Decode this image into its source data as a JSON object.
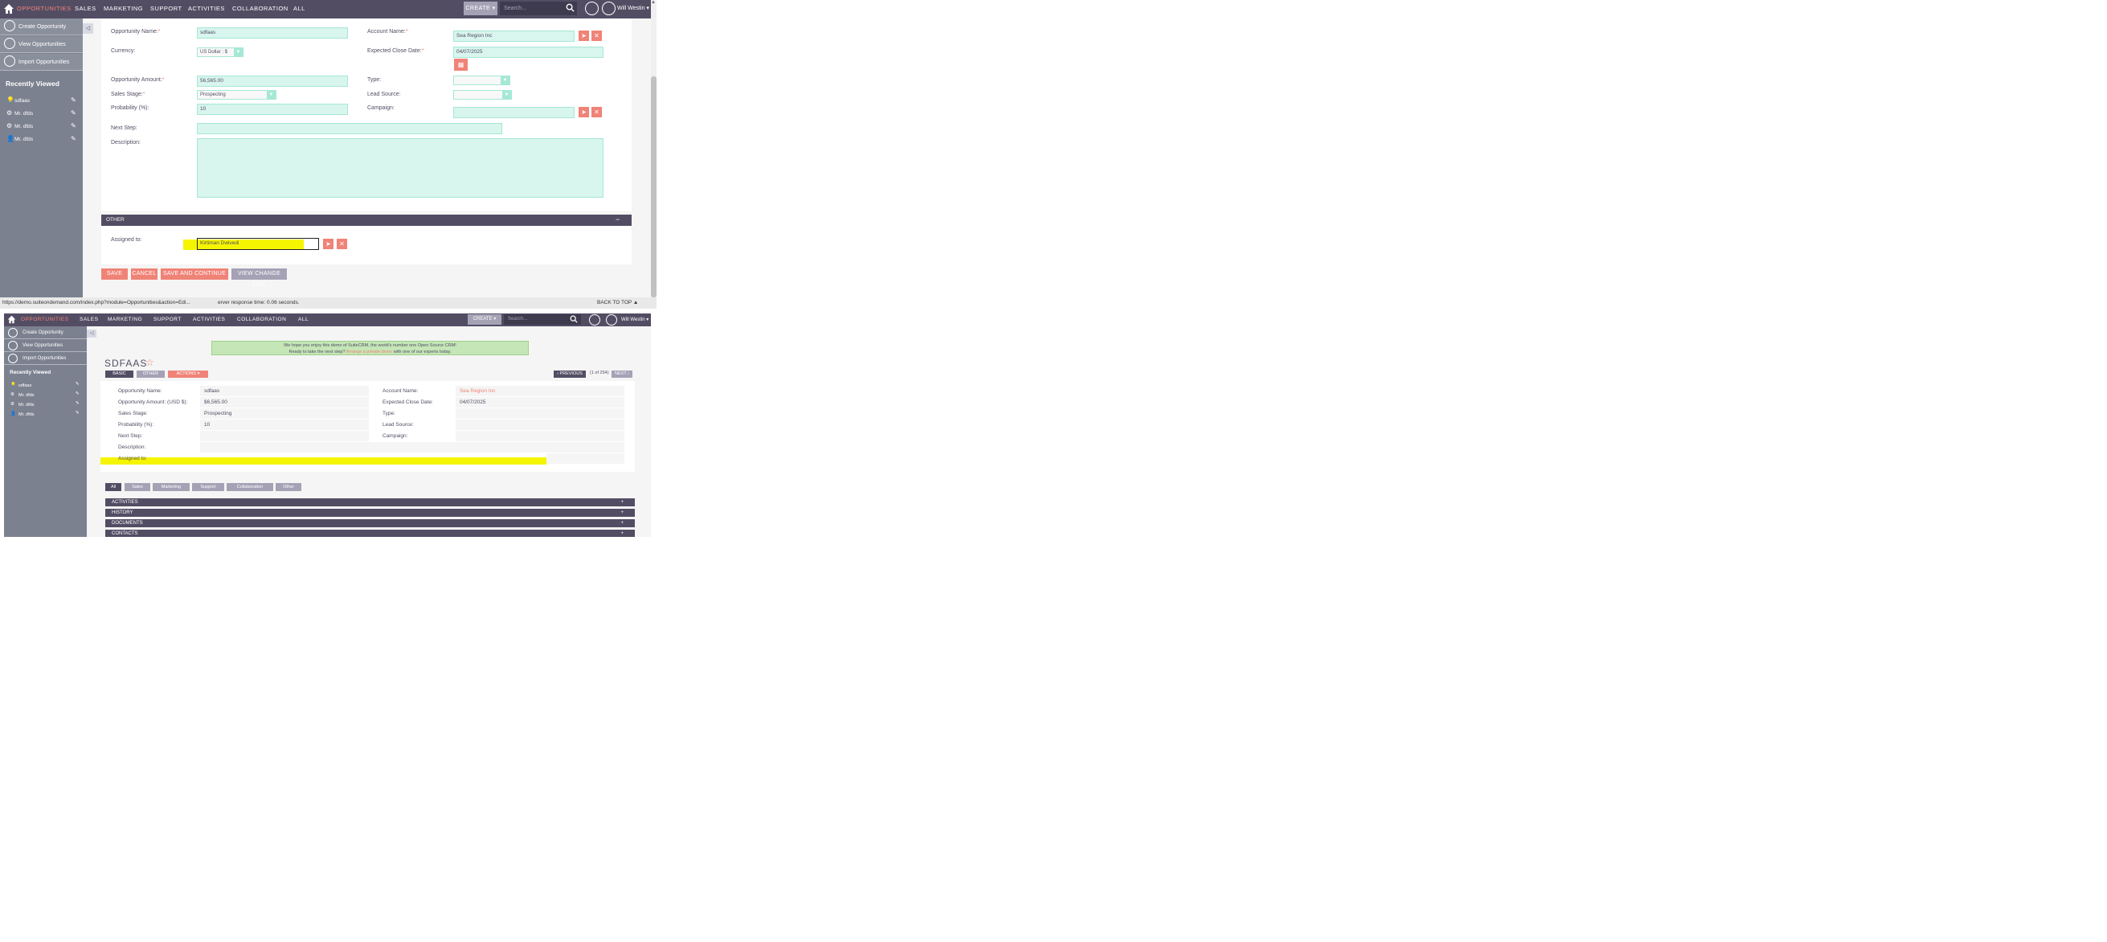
{
  "nav": {
    "items": [
      "OPPORTUNITIES",
      "SALES",
      "MARKETING",
      "SUPPORT",
      "ACTIVITIES",
      "COLLABORATION",
      "ALL"
    ],
    "create_label": "CREATE",
    "search_placeholder": "Search...",
    "user_name": "Will Westin"
  },
  "sidebar": {
    "actions": [
      "Create Opportunity",
      "View Opportunities",
      "Import Opportunities"
    ],
    "recently_viewed_title": "Recently Viewed",
    "recent": [
      {
        "label": "sdfaas",
        "icon": "bulb-icon"
      },
      {
        "label": "Mr. dfds",
        "icon": "gear-icon"
      },
      {
        "label": "Mr. dfds",
        "icon": "gear-icon"
      },
      {
        "label": "Mr. dfds",
        "icon": "person-icon"
      }
    ]
  },
  "edit_form": {
    "opportunity_name_label": "Opportunity Name:",
    "opportunity_name_value": "sdfaas",
    "account_name_label": "Account Name:",
    "account_name_value": "Sea Region Inc",
    "currency_label": "Currency:",
    "currency_value": "US Dollar : $",
    "expected_close_label": "Expected Close Date:",
    "expected_close_value": "04/07/2025",
    "amount_label": "Opportunity Amount:",
    "amount_value": "56,565.00",
    "type_label": "Type:",
    "type_value": "",
    "sales_stage_label": "Sales Stage:",
    "sales_stage_value": "Prospecting",
    "lead_source_label": "Lead Source:",
    "lead_source_value": "",
    "probability_label": "Probability (%):",
    "probability_value": "10",
    "campaign_label": "Campaign:",
    "campaign_value": "",
    "next_step_label": "Next Step:",
    "next_step_value": "",
    "description_label": "Description:",
    "description_value": "",
    "required_mark": "*"
  },
  "other_section": {
    "title": "OTHER",
    "collapse_symbol": "−",
    "assigned_label": "Assigned to:",
    "assigned_value": "Kirtiman Dwivedi"
  },
  "buttons": {
    "save": "SAVE",
    "cancel": "CANCEL",
    "save_continue": "SAVE AND CONTINUE",
    "change_log": "VIEW CHANGE LOG"
  },
  "status_bar": {
    "url": "https://demo.suiteondemand.com/index.php?module=Opportunities&action=Edi...",
    "server_time": "erver response time: 0.06 seconds.",
    "back_to_top": "BACK TO TOP"
  },
  "detail_view": {
    "banner_line1": "We hope you enjoy this demo of SuiteCRM, the world's number one Open Source CRM!",
    "banner_line2_pre": "Ready to take the next step?",
    "banner_link": "Arrange a private demo",
    "banner_line2_post": "with one of our experts today.",
    "title": "SDFAAS",
    "star": "☆",
    "tabs": [
      "BASIC",
      "OTHER",
      "ACTIONS ▾"
    ],
    "previous": "‹ PREVIOUS",
    "pagination": "(1 of 254)",
    "next": "NEXT ›",
    "rows": [
      {
        "label": "Opportunity Name:",
        "value": "sdfaas",
        "label2": "Account Name:",
        "value2": "Sea Region Inc"
      },
      {
        "label": "Opportunity Amount: (USD $):",
        "value": "$6,565.00",
        "label2": "Expected Close Date:",
        "value2": "04/07/2025"
      },
      {
        "label": "Sales Stage:",
        "value": "Prospecting",
        "label2": "Type:",
        "value2": ""
      },
      {
        "label": "Probability (%):",
        "value": "10",
        "label2": "Lead Source:",
        "value2": ""
      },
      {
        "label": "Next Step:",
        "value": "",
        "label2": "Campaign:",
        "value2": ""
      },
      {
        "label": "Description:",
        "value": "",
        "label2": "",
        "value2": ""
      },
      {
        "label": "Assigned to:",
        "value": "",
        "label2": "",
        "value2": ""
      }
    ],
    "filter_tabs": [
      "All",
      "Sales",
      "Marketing",
      "Support",
      "Collaboration",
      "Other"
    ],
    "subpanels": [
      {
        "title": "ACTIVITIES",
        "symbol": "+"
      },
      {
        "title": "HISTORY",
        "symbol": "+"
      },
      {
        "title": "DOCUMENTS",
        "symbol": "+"
      },
      {
        "title": "CONTACTS",
        "symbol": "+"
      }
    ]
  },
  "colors": {
    "nav_bg": "#534d64",
    "accent": "#f08377",
    "input_bg": "#d8f5ee",
    "highlight": "#f5f500"
  }
}
